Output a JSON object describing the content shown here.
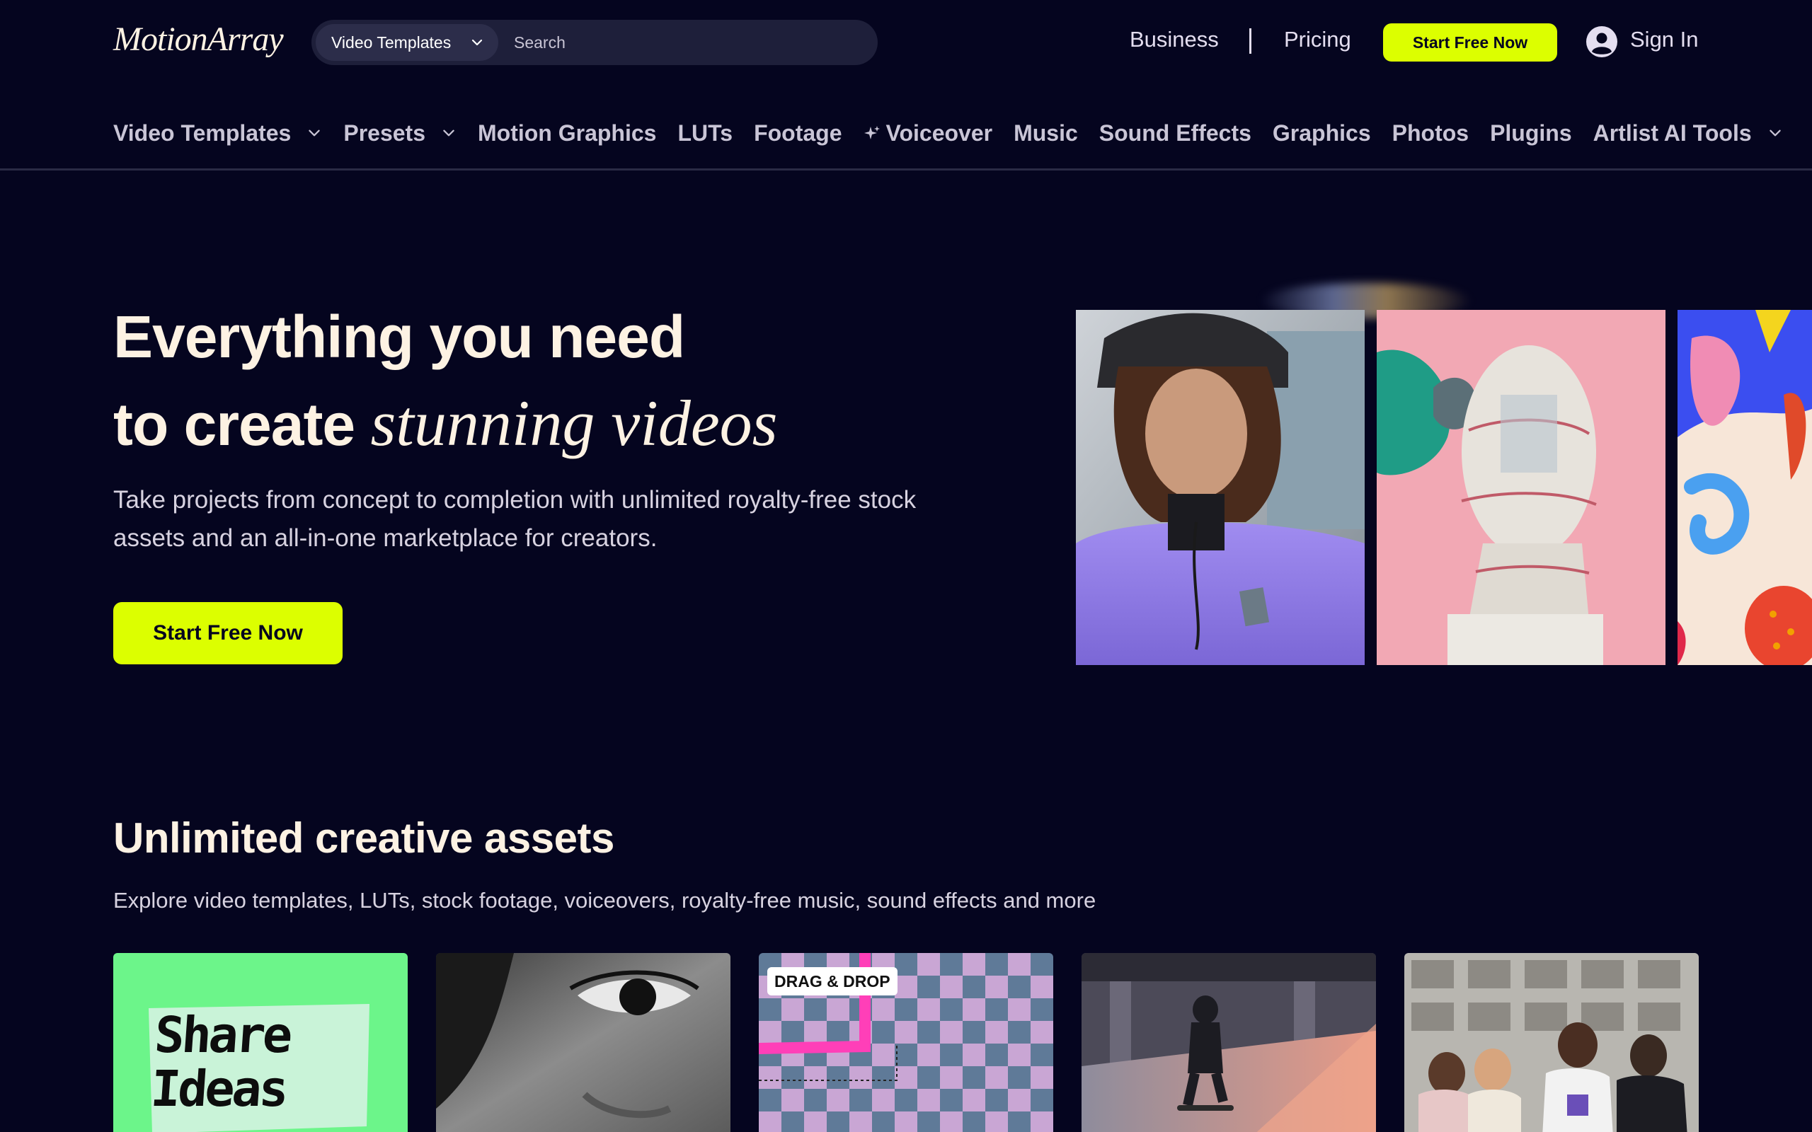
{
  "header": {
    "logo": "MotionArray",
    "search": {
      "category": "Video Templates",
      "placeholder": "Search"
    },
    "links": {
      "business": "Business",
      "pricing": "Pricing"
    },
    "cta": "Start Free Now",
    "sign_in": "Sign In"
  },
  "nav": {
    "items": [
      {
        "label": "Video Templates",
        "has_dropdown": true
      },
      {
        "label": "Presets",
        "has_dropdown": true
      },
      {
        "label": "Motion Graphics",
        "has_dropdown": false
      },
      {
        "label": "LUTs",
        "has_dropdown": false
      },
      {
        "label": "Footage",
        "has_dropdown": false
      },
      {
        "label": "Voiceover",
        "has_dropdown": false,
        "icon": "sparkle-icon"
      },
      {
        "label": "Music",
        "has_dropdown": false
      },
      {
        "label": "Sound Effects",
        "has_dropdown": false
      },
      {
        "label": "Graphics",
        "has_dropdown": false
      },
      {
        "label": "Photos",
        "has_dropdown": false
      },
      {
        "label": "Plugins",
        "has_dropdown": false
      },
      {
        "label": "Artlist AI Tools",
        "has_dropdown": true
      }
    ]
  },
  "hero": {
    "title_line1": "Everything you need",
    "title_line2_plain": "to create ",
    "title_line2_italic": "stunning videos",
    "subtitle": "Take projects from concept to completion with unlimited royalty-free stock assets and an all-in-one marketplace for creators.",
    "cta": "Start Free Now"
  },
  "assets": {
    "title": "Unlimited creative assets",
    "subtitle": "Explore video templates, LUTs, stock footage, voiceovers, royalty-free music, sound effects and more",
    "cards": [
      {
        "name": "card-share-ideas",
        "text": "Share Ideas"
      },
      {
        "name": "card-eye-closeup"
      },
      {
        "name": "card-drag-drop",
        "badge": "DRAG & DROP"
      },
      {
        "name": "card-skater"
      },
      {
        "name": "card-group-portrait"
      }
    ]
  },
  "colors": {
    "background": "#05051f",
    "accent": "#dcff00",
    "text": "#fdf2e3",
    "search_bg": "#1e1f3a"
  }
}
